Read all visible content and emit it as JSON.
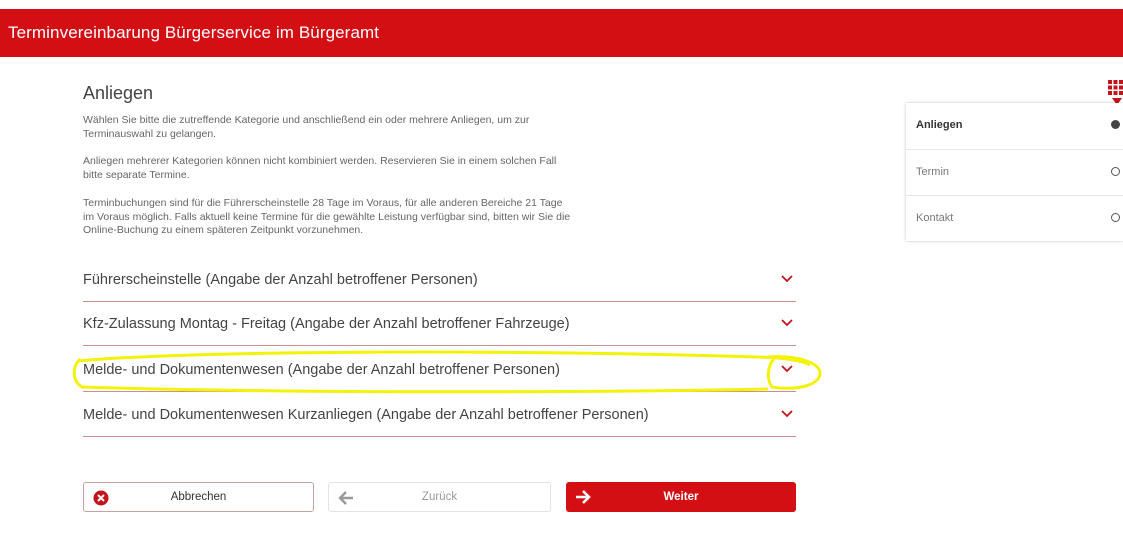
{
  "header": {
    "title": "Terminvereinbarung Bürgerservice im Bürgeramt"
  },
  "main": {
    "heading": "Anliegen",
    "paragraphs": [
      "Wählen Sie bitte die zutreffende Kategorie und anschließend ein oder mehrere Anliegen, um zur Terminauswahl zu gelangen.",
      "Anliegen mehrerer Kategorien können nicht kombiniert werden. Reservieren Sie in einem solchen Fall bitte separate Termine.",
      "Terminbuchungen sind für die Führerscheinstelle 28 Tage im Voraus, für alle anderen Bereiche 21 Tage im Voraus möglich. Falls aktuell keine Termine für die gewählte Leistung verfügbar sind, bitten wir Sie die Online-Buchung zu einem späteren Zeitpunkt vorzunehmen."
    ],
    "categories": [
      {
        "label": "Führerscheinstelle (Angabe der Anzahl betroffener Personen)",
        "icon": "chevron-down-icon"
      },
      {
        "label": "Kfz-Zulassung Montag - Freitag (Angabe der Anzahl betroffener Fahrzeuge)",
        "icon": "chevron-down-icon"
      },
      {
        "label": "Melde- und Dokumentenwesen (Angabe der Anzahl betroffener Personen)",
        "icon": "chevron-down-icon",
        "highlighted": true
      },
      {
        "label": "Melde- und Dokumentenwesen Kurzanliegen (Angabe der Anzahl betroffener Personen)",
        "icon": "chevron-down-icon"
      }
    ]
  },
  "buttons": {
    "cancel": {
      "label": "Abbrechen",
      "icon": "close-circle-icon"
    },
    "back": {
      "label": "Zurück",
      "icon": "arrow-left-icon"
    },
    "next": {
      "label": "Weiter",
      "icon": "arrow-right-icon"
    }
  },
  "steps": [
    {
      "label": "Anliegen",
      "state": "active"
    },
    {
      "label": "Termin",
      "state": "pending"
    },
    {
      "label": "Kontakt",
      "state": "pending"
    }
  ],
  "colors": {
    "brand": "#d40f14",
    "highlight": "#f2f20a",
    "divider": "#c98f91"
  }
}
